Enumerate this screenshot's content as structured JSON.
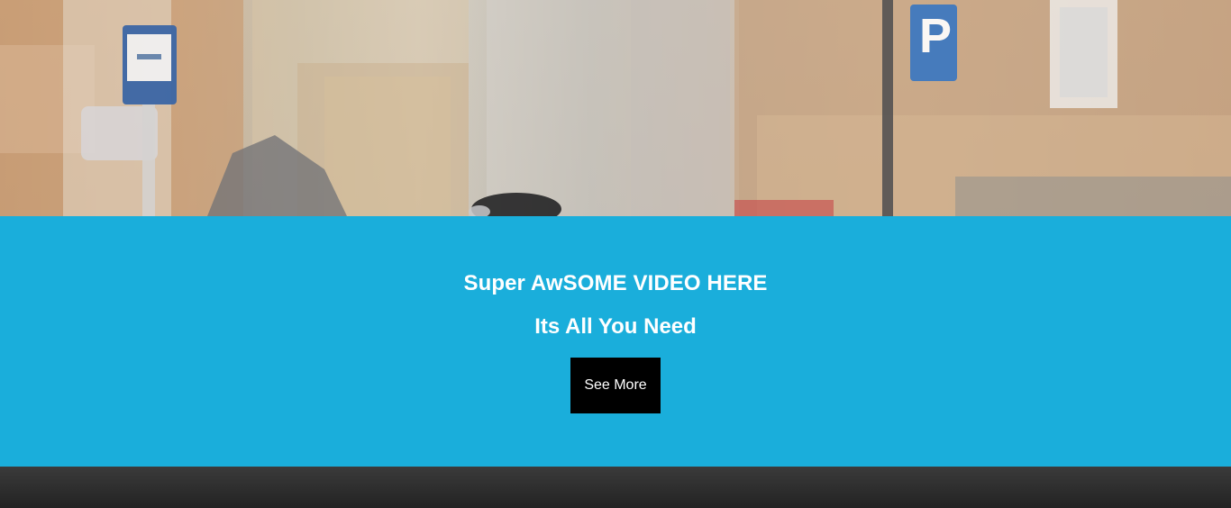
{
  "hero": {
    "title": "Super AwSOME VIDEO HERE",
    "subtitle": "Its All You Need",
    "cta_label": "See More"
  },
  "colors": {
    "band": "#1aaedb",
    "cta_bg": "#000000",
    "text": "#ffffff"
  }
}
